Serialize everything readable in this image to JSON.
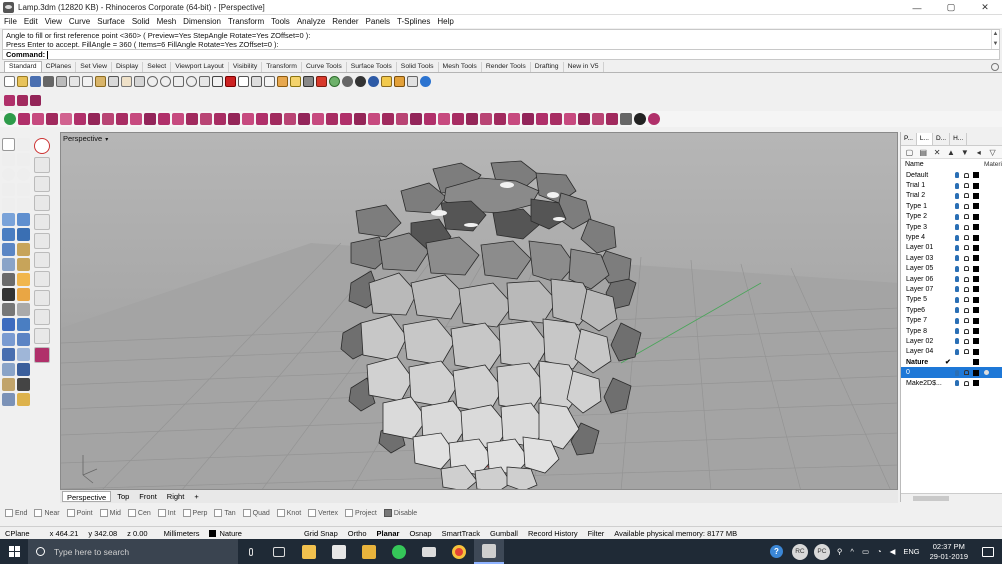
{
  "window": {
    "title": "Lamp.3dm (12820 KB) - Rhinoceros Corporate (64-bit) - [Perspective]",
    "minimize": "—",
    "maximize": "▢",
    "close": "✕"
  },
  "menu": [
    "File",
    "Edit",
    "View",
    "Curve",
    "Surface",
    "Solid",
    "Mesh",
    "Dimension",
    "Transform",
    "Tools",
    "Analyze",
    "Render",
    "Panels",
    "T-Splines",
    "Help"
  ],
  "command": {
    "history_line1": "Angle to fill or first reference point <360> ( Preview=Yes  StepAngle  Rotate=Yes  ZOffset=0 ):",
    "history_line2": "Press Enter to accept. FillAngle = 360 ( Items=6  FillAngle  Rotate=Yes  ZOffset=0 ):",
    "prompt": "Command:"
  },
  "toolbar_tabs": [
    "Standard",
    "CPlanes",
    "Set View",
    "Display",
    "Select",
    "Viewport Layout",
    "Visibility",
    "Transform",
    "Curve Tools",
    "Surface Tools",
    "Solid Tools",
    "Mesh Tools",
    "Render Tools",
    "Drafting",
    "New in V5"
  ],
  "viewport": {
    "title": "Perspective",
    "dropdown": "▾",
    "tabs": [
      "Perspective",
      "Top",
      "Front",
      "Right"
    ],
    "add_tab": "+"
  },
  "layers_panel": {
    "tabs": [
      "P...",
      "L...",
      "D...",
      "H..."
    ],
    "col_name": "Name",
    "col_material": "Materi",
    "layers": [
      {
        "name": "Default"
      },
      {
        "name": "Trial 1"
      },
      {
        "name": "Trial 2"
      },
      {
        "name": "Type 1"
      },
      {
        "name": "Type 2"
      },
      {
        "name": "Type 3"
      },
      {
        "name": "type 4"
      },
      {
        "name": "Layer 01"
      },
      {
        "name": "Layer 03"
      },
      {
        "name": "Layer 05"
      },
      {
        "name": "Layer 06"
      },
      {
        "name": "Layer 07"
      },
      {
        "name": "Type 5"
      },
      {
        "name": "Type6"
      },
      {
        "name": "Type 7"
      },
      {
        "name": "Type 8"
      },
      {
        "name": "Layer 02"
      },
      {
        "name": "Layer 04"
      },
      {
        "name": "Nature",
        "current": true,
        "check": "✔"
      },
      {
        "name": "0",
        "selected": true
      },
      {
        "name": "Make2D$..."
      }
    ]
  },
  "osnap": [
    "End",
    "Near",
    "Point",
    "Mid",
    "Cen",
    "Int",
    "Perp",
    "Tan",
    "Quad",
    "Knot",
    "Vertex",
    "Project",
    "Disable"
  ],
  "status": {
    "cplane": "CPlane",
    "x": "x 464.21",
    "y": "y 342.08",
    "z": "z 0.00",
    "units": "Millimeters",
    "layer": "Nature",
    "grid_snap": "Grid Snap",
    "ortho": "Ortho",
    "planar": "Planar",
    "osnap": "Osnap",
    "smarttrack": "SmartTrack",
    "gumball": "Gumball",
    "record_history": "Record History",
    "filter": "Filter",
    "memory": "Available physical memory: 8177 MB"
  },
  "taskbar": {
    "search_placeholder": "Type here to search",
    "help": "?",
    "avatar1": "RC",
    "avatar2": "PC",
    "lang": "ENG",
    "time": "02:37 PM",
    "date": "29-01-2019"
  },
  "colors": {
    "viewport_bg": "#a3a3a3",
    "selection": "#1e78d7",
    "taskbar": "#1f2a36"
  }
}
